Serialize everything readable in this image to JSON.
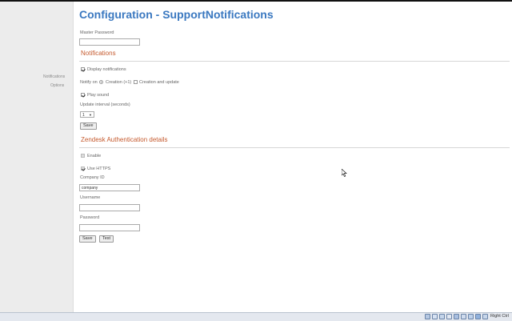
{
  "page": {
    "title": "Configuration - SupportNotifications"
  },
  "sidebar": {
    "items": [
      {
        "label": "Notifications"
      },
      {
        "label": "Options"
      }
    ]
  },
  "master": {
    "label": "Master Password",
    "value": ""
  },
  "notifications": {
    "heading": "Notifications",
    "display_label": "Display notifications",
    "display_checked": true,
    "notify_on_label": "Notify on",
    "radio1_label": "Creation (+1)",
    "radio2_label": "Creation and update",
    "play_sound_label": "Play sound",
    "play_sound_checked": true,
    "interval_label": "Update interval (seconds)",
    "interval_value": "1",
    "save_label": "Save"
  },
  "zendesk": {
    "heading": "Zendesk Authentication details",
    "enable_label": "Enable",
    "https_label": "Use HTTPS",
    "company_label": "Company ID",
    "company_value": "company",
    "username_label": "Username",
    "username_value": "",
    "password_label": "Password",
    "password_value": "",
    "save_label": "Save",
    "test_label": "Test"
  },
  "taskbar": {
    "right_ctrl": "Right Ctrl"
  },
  "colors": {
    "title": "#3a78c0",
    "section": "#c55a2e",
    "sidebar_bg": "#ececec"
  }
}
